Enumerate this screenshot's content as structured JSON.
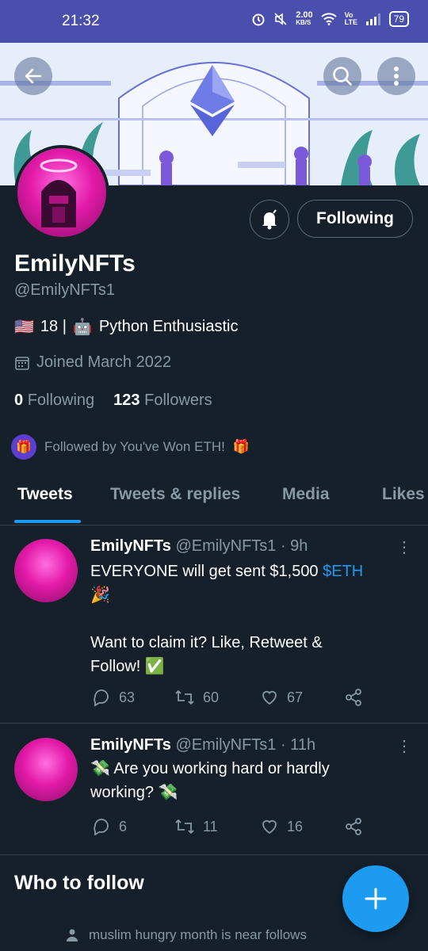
{
  "status_bar": {
    "time": "21:32",
    "speed": "2.00",
    "speed_unit": "KB/S",
    "volte": "Vo LTE",
    "battery": "79"
  },
  "icons": {
    "back": "arrow-left-icon",
    "search": "search-icon",
    "more": "more-vertical-icon",
    "bell": "bell-icon",
    "calendar": "calendar-icon",
    "reply": "reply-icon",
    "retweet": "retweet-icon",
    "like": "heart-icon",
    "share": "share-icon",
    "compose": "plus-icon"
  },
  "profile": {
    "name": "EmilyNFTs",
    "handle": "@EmilyNFTs1",
    "bio_flag": "🇺🇸",
    "bio_text_1": "18 |",
    "bio_robot": "🤖",
    "bio_text_2": "Python Enthusiastic",
    "joined": "Joined March 2022",
    "following_count": "0",
    "following_label": "Following",
    "followers_count": "123",
    "followers_label": "Followers",
    "followed_by": "Followed by You've Won ETH!",
    "followed_by_emoji": "🎁",
    "follow_button": "Following"
  },
  "tabs": [
    {
      "label": "Tweets",
      "active": true
    },
    {
      "label": "Tweets & replies",
      "active": false
    },
    {
      "label": "Media",
      "active": false
    },
    {
      "label": "Likes",
      "active": false
    }
  ],
  "tweets": [
    {
      "name": "EmilyNFTs",
      "meta": "@EmilyNFTs1 · 9h",
      "line1": "EVERYONE will get sent $1,500",
      "link": "$ETH",
      "line2": "🎉",
      "line3": "Want to claim it? Like, Retweet &",
      "line4": "Follow! ✅",
      "replies": "63",
      "retweets": "60",
      "likes": "67"
    },
    {
      "name": "EmilyNFTs",
      "meta": "@EmilyNFTs1 · 11h",
      "line1": "💸 Are you working hard or hardly",
      "line2": "working? 💸",
      "replies": "6",
      "retweets": "11",
      "likes": "16"
    }
  ],
  "who_to_follow": {
    "title": "Who to follow",
    "subtitle": "muslim hungry month is near follows"
  },
  "colors": {
    "background": "#15202b",
    "accent": "#1d9bf0",
    "muted": "#8899a6",
    "status_bar": "#4a4fae"
  }
}
